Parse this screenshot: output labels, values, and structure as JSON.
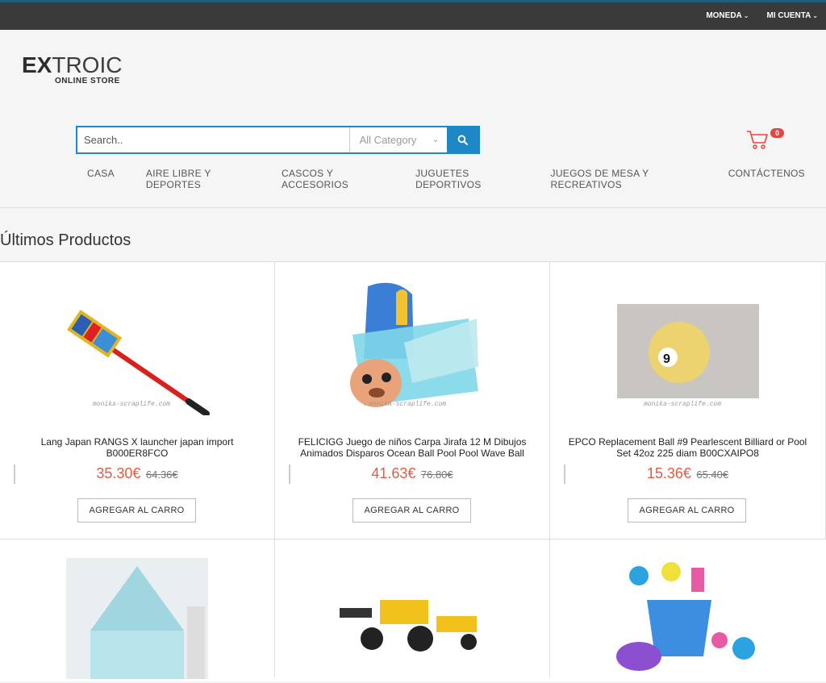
{
  "topbar": {
    "currency_label": "MONEDA",
    "account_label": "MI CUENTA"
  },
  "logo": {
    "brand_bold": "EX",
    "brand_rest": "TROIC",
    "tagline": "ONLINE STORE"
  },
  "search": {
    "placeholder": "Search..",
    "category": "All Category"
  },
  "cart": {
    "count": "0"
  },
  "nav": [
    "CASA",
    "AIRE LIBRE Y DEPORTES",
    "CASCOS Y ACCESORIOS",
    "JUGUETES DEPORTIVOS",
    "JUEGOS DE MESA Y RECREATIVOS",
    "CONTÁCTENOS"
  ],
  "section_title": "Últimos Productos",
  "products": [
    {
      "name": "Lang Japan RANGS X launcher japan import B000ER8FCO",
      "price": "35.30€",
      "old_price": "64.36€",
      "button": "AGREGAR AL CARRO",
      "watermark": "monika-scraplife.com"
    },
    {
      "name": "FELICIGG Juego de niños Carpa Jirafa 12 M Dibujos Animados Disparos Ocean Ball Pool Pool Wave Ball",
      "price": "41.63€",
      "old_price": "76.80€",
      "button": "AGREGAR AL CARRO",
      "watermark": "monika-scraplife.com"
    },
    {
      "name": "EPCO Replacement Ball #9 Pearlescent Billiard or Pool Set 42oz 225 diam B00CXAIPO8",
      "price": "15.36€",
      "old_price": "65.40€",
      "button": "AGREGAR AL CARRO",
      "watermark": "monika-scraplife.com",
      "ball_number": "9"
    }
  ],
  "colors": {
    "accent": "#1e88c7",
    "price": "#e35a3c",
    "badge": "#e8453c",
    "topbar": "#3a3a3a"
  }
}
